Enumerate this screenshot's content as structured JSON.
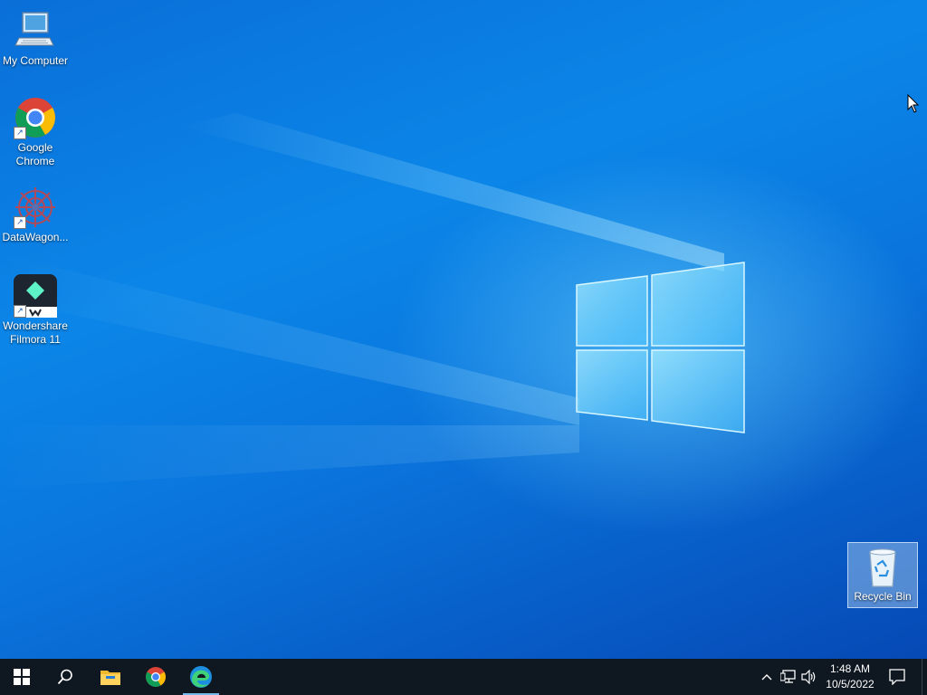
{
  "desktop": {
    "icons": [
      {
        "label": "My Computer",
        "icon": "computer-icon",
        "shortcut": false
      },
      {
        "label": "Google Chrome",
        "icon": "chrome-icon",
        "shortcut": true
      },
      {
        "label": "DataWagon...",
        "icon": "datawagon-icon",
        "shortcut": true
      },
      {
        "label": "Wondershare Filmora 11",
        "icon": "filmora-icon",
        "shortcut": true
      },
      {
        "label": "Recycle Bin",
        "icon": "recycle-bin-icon",
        "shortcut": false,
        "selected": true
      }
    ],
    "wallpaper_colors": {
      "base": "#0a74dc",
      "glow": "#78dcff"
    }
  },
  "taskbar": {
    "background": "#0f1720",
    "pinned": [
      {
        "icon": "windows-start-icon",
        "name": "Start"
      },
      {
        "icon": "search-icon",
        "name": "Search"
      },
      {
        "icon": "file-explorer-icon",
        "name": "File Explorer"
      },
      {
        "icon": "chrome-icon",
        "name": "Google Chrome"
      },
      {
        "icon": "edge-icon",
        "name": "Microsoft Edge",
        "active": true
      }
    ],
    "tray": {
      "icons": [
        "chevron-up-icon",
        "network-icon",
        "volume-icon"
      ],
      "time": "1:48 AM",
      "date": "10/5/2022",
      "notification_icon": "action-center-icon"
    }
  }
}
